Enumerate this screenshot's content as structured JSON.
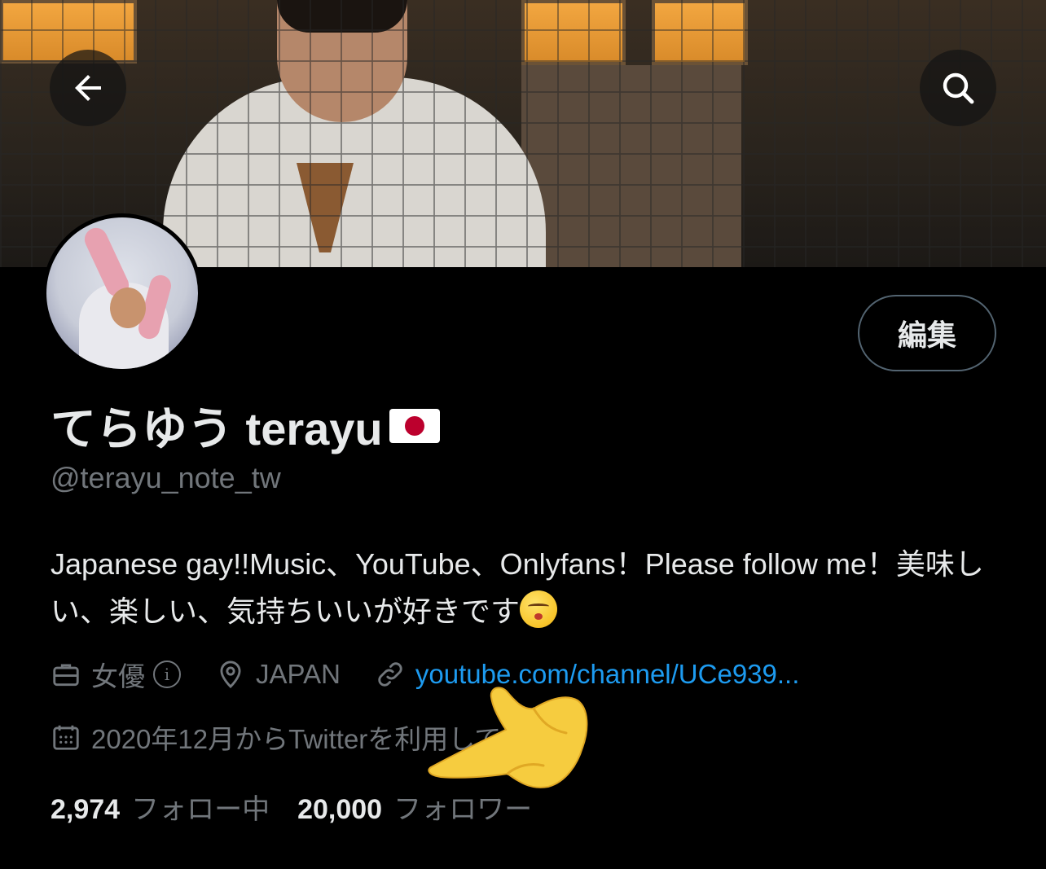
{
  "header": {
    "back_icon": "arrow-left-icon",
    "search_icon": "search-icon"
  },
  "profile": {
    "edit_label": "編集",
    "display_name": "てらゆう terayu",
    "flag_icon": "japan-flag-icon",
    "handle": "@terayu_note_tw",
    "bio_text": "Japanese gay!!Music、YouTube、Onlyfans！Please follow me！美味しい、楽しい、気持ちいいが好きです",
    "bio_emoji": "kissing-face-emoji",
    "category": "女優",
    "location": "JAPAN",
    "website": "youtube.com/channel/UCe939...",
    "joined": "2020年12月からTwitterを利用しています"
  },
  "stats": {
    "following_count": "2,974",
    "following_label": "フォロー中",
    "followers_count": "20,000",
    "followers_label": "フォロワー"
  },
  "overlay": {
    "pointer_emoji": "pointing-hand-emoji"
  },
  "colors": {
    "background": "#000000",
    "text_primary": "#e7e9ea",
    "text_secondary": "#71767b",
    "link": "#1d9bf0",
    "border": "#536471"
  }
}
